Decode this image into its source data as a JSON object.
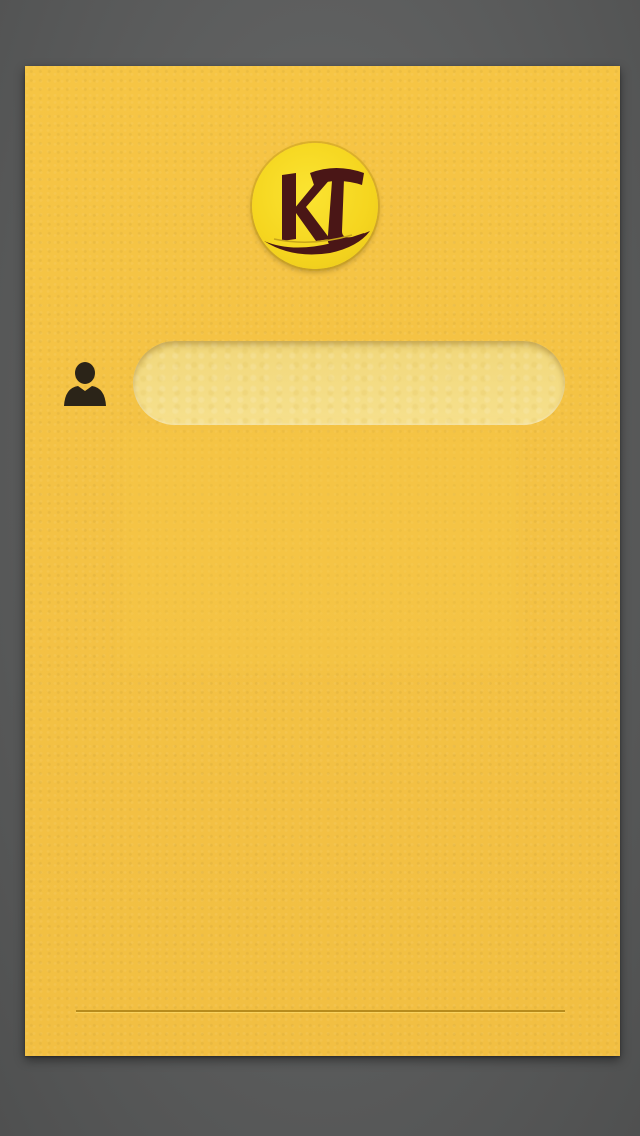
{
  "app": {
    "logo_text": "KT",
    "logo_icon": "kt-monogram-logo"
  },
  "login_form": {
    "username_icon": "user-icon",
    "username_value": "",
    "username_placeholder": ""
  },
  "colors": {
    "background": "#5e5f5f",
    "card": "#f4c244",
    "logo_circle": "#f5d51f",
    "logo_ink": "#4a1616",
    "field": "#f3db82",
    "icon": "#2b2418",
    "divider": "#b88c1c"
  }
}
